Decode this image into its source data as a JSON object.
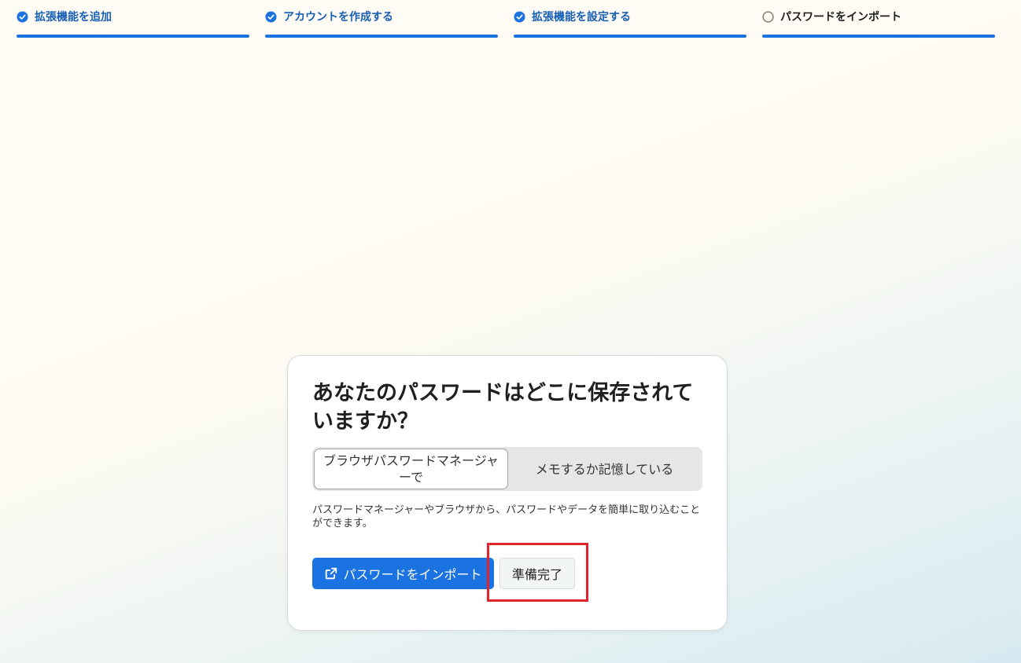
{
  "steps": [
    {
      "label": "拡張機能を追加",
      "status": "done",
      "icon": "check-circle-icon"
    },
    {
      "label": "アカウントを作成する",
      "status": "done",
      "icon": "check-circle-icon"
    },
    {
      "label": "拡張機能を設定する",
      "status": "done",
      "icon": "check-circle-icon"
    },
    {
      "label": "パスワードをインポート",
      "status": "pending",
      "icon": "empty-circle-icon"
    }
  ],
  "card": {
    "title": "あなたのパスワードはどこに保存されていますか？",
    "options": [
      {
        "label": "ブラウザパスワードマネージャーで",
        "selected": true
      },
      {
        "label": "メモするか記憶している",
        "selected": false
      }
    ],
    "description": "パスワードマネージャーやブラウザから、パスワードやデータを簡単に取り込むことができます。",
    "import_button": {
      "label": "パスワードをインポート",
      "icon": "external-link-icon"
    },
    "ready_button": {
      "label": "準備完了"
    }
  },
  "colors": {
    "accent": "#1a73e0",
    "step_done_text": "#175fb5",
    "pending_circle": "#8a7a6a",
    "highlight": "#e0242a"
  }
}
